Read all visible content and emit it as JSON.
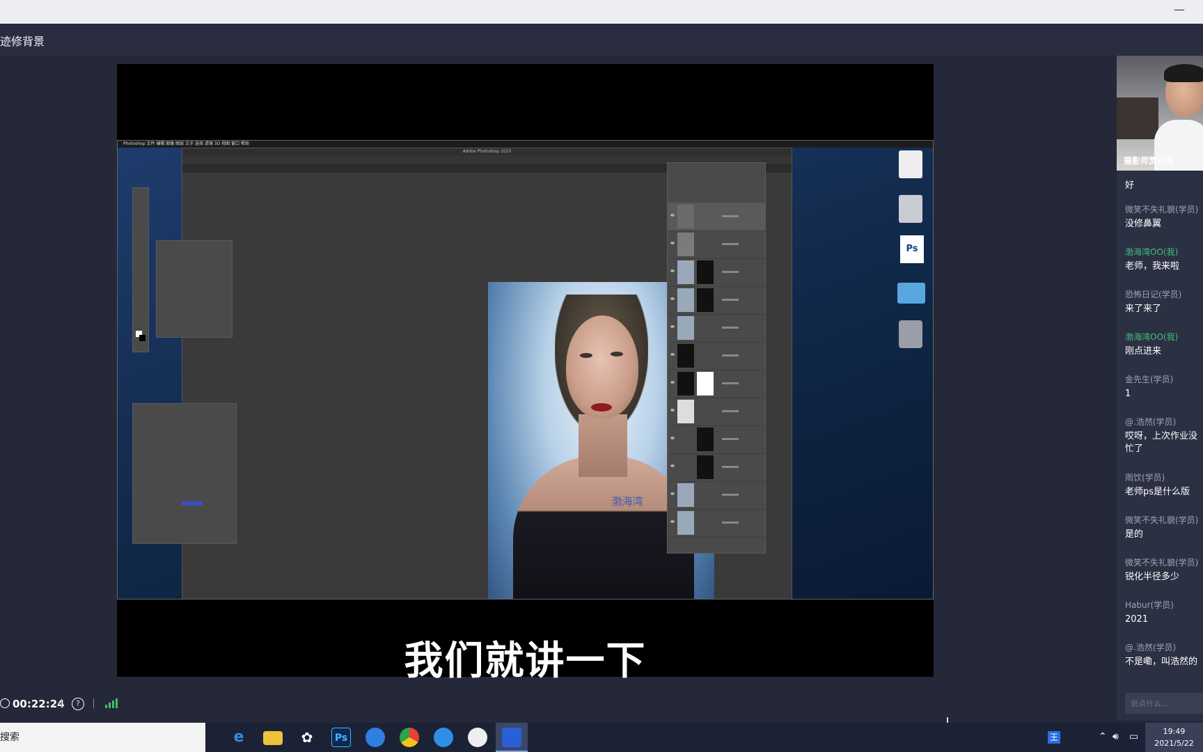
{
  "window": {
    "minimize_label": "—"
  },
  "header": {
    "course_title": "迹修背景"
  },
  "video": {
    "ps_menu": "  Photoshop  文件  编辑  图像  图层  文字  选择  滤镜  3D  视图  窗口  帮助",
    "ps_title": "Adobe Photoshop 2020",
    "watermark": "渤海湾",
    "subtitle": "我们就讲一下"
  },
  "status": {
    "timer": "00:22:24",
    "help_icon": "?"
  },
  "teacher": {
    "name": "摄影师贾云龙"
  },
  "chat": {
    "messages": [
      {
        "sender": "",
        "text": "好",
        "me": false
      },
      {
        "sender": "微笑不失礼貌(学员)",
        "text": "没修鼻翼",
        "me": false
      },
      {
        "sender": "渤海湾OO(我)",
        "text": "老师，我来啦",
        "me": true
      },
      {
        "sender": "恐怖日记(学员)",
        "text": "来了来了",
        "me": false
      },
      {
        "sender": "渤海湾OO(我)",
        "text": "刚点进来",
        "me": true
      },
      {
        "sender": "金先生(学员)",
        "text": "1",
        "me": false
      },
      {
        "sender": "@.浩然(学员)",
        "text": "哎呀，上次作业没\n忙了",
        "me": false
      },
      {
        "sender": "雨饮(学员)",
        "text": "老师ps是什么版",
        "me": false
      },
      {
        "sender": "微笑不失礼貌(学员)",
        "text": "是的",
        "me": false
      },
      {
        "sender": "微笑不失礼貌(学员)",
        "text": "锐化半径多少",
        "me": false
      },
      {
        "sender": "Habur(学员)",
        "text": "2021",
        "me": false
      },
      {
        "sender": "@.浩然(学员)",
        "text": "不是嘞，叫浩然的",
        "me": false
      }
    ],
    "input_placeholder": "说点什么..."
  },
  "taskbar": {
    "search_label": "搜索",
    "ps_icon": "Ps",
    "time": "19:49",
    "date": "2021/5/22",
    "ime": "王"
  },
  "colors": {
    "accent": "#3fc07a",
    "background": "#252838",
    "taskbar": "#1c2235"
  }
}
